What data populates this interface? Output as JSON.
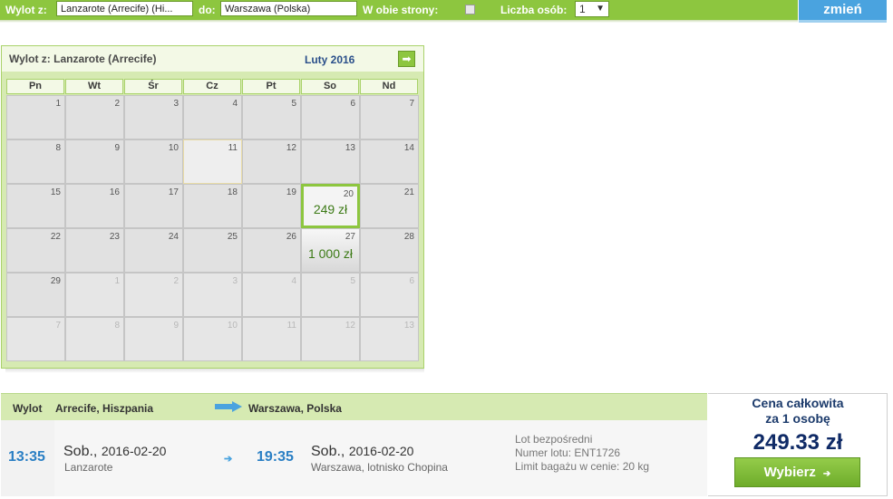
{
  "search": {
    "from_label": "Wylot z:",
    "from_value": "Lanzarote (Arrecife) (Hi...",
    "to_label": "do:",
    "to_value": "Warszawa (Polska)",
    "roundtrip_label": "W obie strony:",
    "roundtrip_checked": false,
    "persons_label": "Liczba osób:",
    "persons_value": "1",
    "change_button": "zmień"
  },
  "calendar": {
    "from_text": "Wylot z: Lanzarote (Arrecife)",
    "month": "Luty 2016",
    "weekdays": [
      "Pn",
      "Wt",
      "Śr",
      "Cz",
      "Pt",
      "So",
      "Nd"
    ],
    "weeks": [
      [
        {
          "d": "1"
        },
        {
          "d": "2"
        },
        {
          "d": "3"
        },
        {
          "d": "4"
        },
        {
          "d": "5"
        },
        {
          "d": "6"
        },
        {
          "d": "7"
        }
      ],
      [
        {
          "d": "8"
        },
        {
          "d": "9"
        },
        {
          "d": "10"
        },
        {
          "d": "11",
          "today": true
        },
        {
          "d": "12"
        },
        {
          "d": "13"
        },
        {
          "d": "14"
        }
      ],
      [
        {
          "d": "15"
        },
        {
          "d": "16"
        },
        {
          "d": "17"
        },
        {
          "d": "18"
        },
        {
          "d": "19"
        },
        {
          "d": "20",
          "price": "249 zł",
          "selected": true
        },
        {
          "d": "21"
        }
      ],
      [
        {
          "d": "22"
        },
        {
          "d": "23"
        },
        {
          "d": "24"
        },
        {
          "d": "25"
        },
        {
          "d": "26"
        },
        {
          "d": "27",
          "price": "1 000 zł"
        },
        {
          "d": "28"
        }
      ],
      [
        {
          "d": "29"
        },
        {
          "d": "1",
          "other": true
        },
        {
          "d": "2",
          "other": true
        },
        {
          "d": "3",
          "other": true
        },
        {
          "d": "4",
          "other": true
        },
        {
          "d": "5",
          "other": true
        },
        {
          "d": "6",
          "other": true
        }
      ],
      [
        {
          "d": "7",
          "other": true
        },
        {
          "d": "8",
          "other": true
        },
        {
          "d": "9",
          "other": true
        },
        {
          "d": "10",
          "other": true
        },
        {
          "d": "11",
          "other": true
        },
        {
          "d": "12",
          "other": true
        },
        {
          "d": "13",
          "other": true
        }
      ]
    ]
  },
  "flight": {
    "header_label": "Wylot",
    "origin": "Arrecife, Hiszpania",
    "destination": "Warszawa, Polska",
    "dep_time": "13:35",
    "dep_day": "Sob.,",
    "dep_date": "2016-02-20",
    "dep_airport": "Lanzarote",
    "arr_time": "19:35",
    "arr_day": "Sob.,",
    "arr_date": "2016-02-20",
    "arr_airport": "Warszawa, lotnisko Chopina",
    "info_direct": "Lot bezpośredni",
    "info_flight_no": "Numer lotu: ENT1726",
    "info_baggage": "Limit bagażu w cenie: 20 kg"
  },
  "price": {
    "title_line1": "Cena całkowita",
    "title_line2": "za 1 osobę",
    "amount": "249.33 zł",
    "select_button": "Wybierz"
  },
  "colors": {
    "accent_green": "#8dc63f",
    "accent_blue": "#4aa3df",
    "price_navy": "#0f2a66"
  }
}
